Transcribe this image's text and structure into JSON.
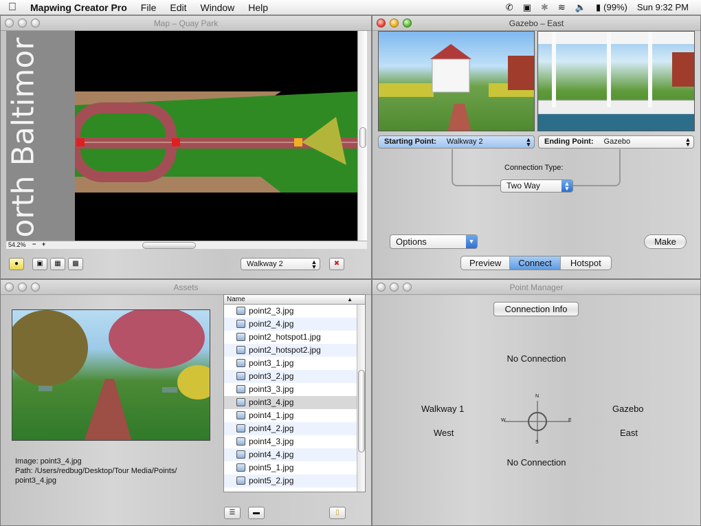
{
  "menubar": {
    "app": "Mapwing Creator Pro",
    "menus": [
      "File",
      "Edit",
      "Window",
      "Help"
    ],
    "battery": "(99%)",
    "clock": "Sun 9:32 PM"
  },
  "map_window": {
    "title": "Map – Quay Park",
    "side_text": "orth Baltimor",
    "zoom": "54.2%",
    "point_select": "Walkway 2"
  },
  "gazebo_window": {
    "title": "Gazebo – East",
    "starting_label": "Starting Point:",
    "starting_value": "Walkway 2",
    "ending_label": "Ending Point:",
    "ending_value": "Gazebo",
    "conn_type_label": "Connection Type:",
    "conn_type_value": "Two Way",
    "options": "Options",
    "make": "Make",
    "tabs": [
      "Preview",
      "Connect",
      "Hotspot"
    ]
  },
  "assets_window": {
    "title": "Assets",
    "column_name": "Name",
    "files": [
      "point2_3.jpg",
      "point2_4.jpg",
      "point2_hotspot1.jpg",
      "point2_hotspot2.jpg",
      "point3_1.jpg",
      "point3_2.jpg",
      "point3_3.jpg",
      "point3_4.jpg",
      "point4_1.jpg",
      "point4_2.jpg",
      "point4_3.jpg",
      "point4_4.jpg",
      "point5_1.jpg",
      "point5_2.jpg"
    ],
    "selected_index": 7,
    "info_image": "Image: point3_4.jpg",
    "info_path": "Path: /Users/redbug/Desktop/Tour Media/Points/",
    "info_path2": "point3_4.jpg"
  },
  "point_manager": {
    "title": "Point Manager",
    "conn_info": "Connection Info",
    "top": "No Connection",
    "bottom": "No Connection",
    "left_name": "Walkway 1",
    "left_dir": "West",
    "right_name": "Gazebo",
    "right_dir": "East",
    "compass": {
      "n": "N",
      "s": "S",
      "e": "E",
      "w": "W"
    }
  },
  "colors": {
    "accent": "#3b7fd8",
    "map_green": "#2f8a24",
    "path": "#a34e55"
  }
}
